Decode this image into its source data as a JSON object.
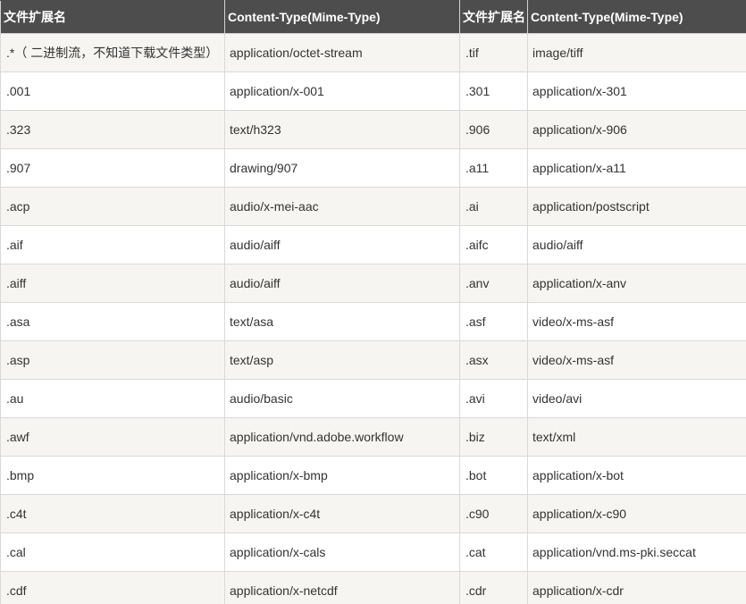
{
  "table": {
    "headers": [
      "文件扩展名",
      "Content-Type(Mime-Type)",
      "文件扩展名",
      "Content-Type(Mime-Type)"
    ],
    "rows": [
      [
        ".*（ 二进制流，不知道下载文件类型）",
        "application/octet-stream",
        ".tif",
        "image/tiff"
      ],
      [
        ".001",
        "application/x-001",
        ".301",
        "application/x-301"
      ],
      [
        ".323",
        "text/h323",
        ".906",
        "application/x-906"
      ],
      [
        ".907",
        "drawing/907",
        ".a11",
        "application/x-a11"
      ],
      [
        ".acp",
        "audio/x-mei-aac",
        ".ai",
        "application/postscript"
      ],
      [
        ".aif",
        "audio/aiff",
        ".aifc",
        "audio/aiff"
      ],
      [
        ".aiff",
        "audio/aiff",
        ".anv",
        "application/x-anv"
      ],
      [
        ".asa",
        "text/asa",
        ".asf",
        "video/x-ms-asf"
      ],
      [
        ".asp",
        "text/asp",
        ".asx",
        "video/x-ms-asf"
      ],
      [
        ".au",
        "audio/basic",
        ".avi",
        "video/avi"
      ],
      [
        ".awf",
        "application/vnd.adobe.workflow",
        ".biz",
        "text/xml"
      ],
      [
        ".bmp",
        "application/x-bmp",
        ".bot",
        "application/x-bot"
      ],
      [
        ".c4t",
        "application/x-c4t",
        ".c90",
        "application/x-c90"
      ],
      [
        ".cal",
        "application/x-cals",
        ".cat",
        "application/vnd.ms-pki.seccat"
      ],
      [
        ".cdf",
        "application/x-netcdf",
        ".cdr",
        "application/x-cdr"
      ]
    ]
  }
}
